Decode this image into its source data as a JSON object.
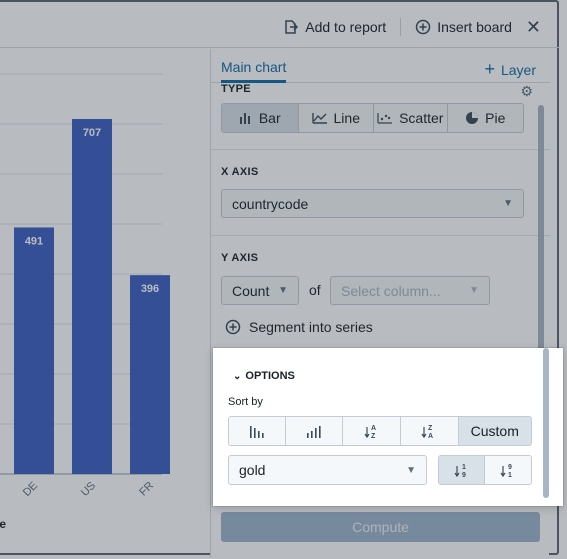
{
  "topbar": {
    "add_to_report": "Add to report",
    "insert_board": "Insert board",
    "close": "✕"
  },
  "chart": {
    "xlabel": "de",
    "chart_data": {
      "type": "bar",
      "categories": [
        "DE",
        "US",
        "FR"
      ],
      "values": [
        491,
        707,
        396
      ],
      "xlabel": "de",
      "ylabel": "",
      "ylim": [
        0,
        800
      ]
    }
  },
  "panel": {
    "tab_main": "Main chart",
    "tab_layer": "Layer",
    "type_label": "TYPE",
    "types": [
      "Bar",
      "Line",
      "Scatter",
      "Pie"
    ],
    "x_axis_label": "X AXIS",
    "x_axis_value": "countrycode",
    "y_axis_label": "Y AXIS",
    "y_agg": "Count",
    "of": "of",
    "y_column_placeholder": "Select column...",
    "segment": "Segment into series",
    "options": "OPTIONS",
    "sort_by": "Sort by",
    "sort_custom": "Custom",
    "sort_field": "gold",
    "compute": "Compute"
  },
  "colors": {
    "bar": "#3b5fc0",
    "accent": "#106ba3"
  }
}
